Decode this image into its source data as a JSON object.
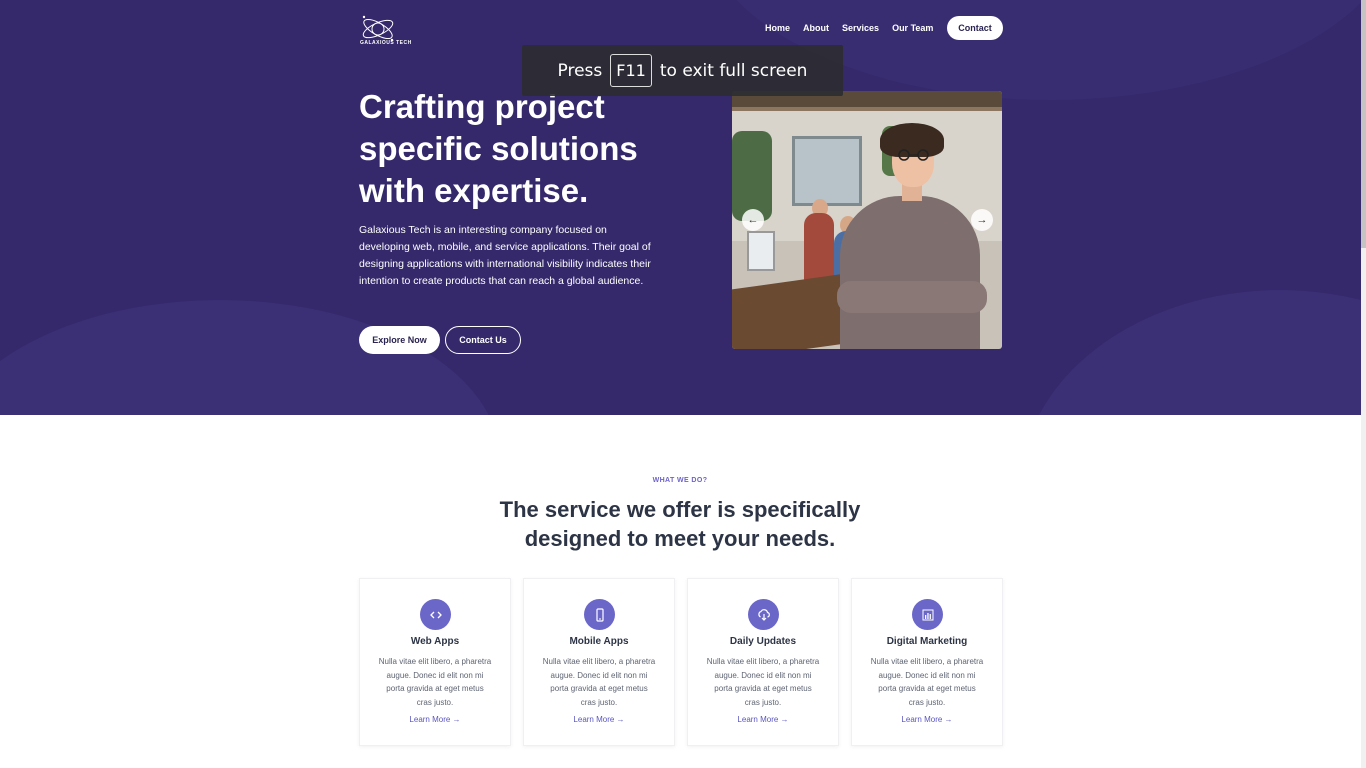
{
  "brand": {
    "logo_text": "GALAXIOUS TECH"
  },
  "nav": {
    "items": [
      "Home",
      "About",
      "Services",
      "Our Team"
    ],
    "contact_label": "Contact"
  },
  "fullscreen_notice": {
    "prefix": "Press",
    "key": "F11",
    "suffix": "to exit full screen"
  },
  "hero": {
    "title": "Crafting project specific solutions with expertise.",
    "description": "Galaxious Tech is an interesting company focused on developing web, mobile, and service applications. Their goal of designing applications with international visibility indicates their intention to create products that can reach a global audience.",
    "explore_label": "Explore Now",
    "contact_us_label": "Contact Us",
    "carousel_prev": "←",
    "carousel_next": "→"
  },
  "services": {
    "eyebrow": "WHAT WE DO?",
    "title": "The service we offer is specifically designed to meet your needs.",
    "cards": [
      {
        "icon": "code-icon",
        "title": "Web Apps",
        "text": "Nulla vitae elit libero, a pharetra augue. Donec id elit non mi porta gravida at eget metus cras justo.",
        "link": "Learn More →"
      },
      {
        "icon": "mobile-icon",
        "title": "Mobile Apps",
        "text": "Nulla vitae elit libero, a pharetra augue. Donec id elit non mi porta gravida at eget metus cras justo.",
        "link": "Learn More →"
      },
      {
        "icon": "cloud-download-icon",
        "title": "Daily Updates",
        "text": "Nulla vitae elit libero, a pharetra augue. Donec id elit non mi porta gravida at eget metus cras justo.",
        "link": "Learn More →"
      },
      {
        "icon": "bar-chart-icon",
        "title": "Digital Marketing",
        "text": "Nulla vitae elit libero, a pharetra augue. Donec id elit non mi porta gravida at eget metus cras justo.",
        "link": "Learn More →"
      }
    ]
  },
  "colors": {
    "hero_bg": "#35296b",
    "accent": "#6a67c9",
    "heading": "#2d3445"
  }
}
